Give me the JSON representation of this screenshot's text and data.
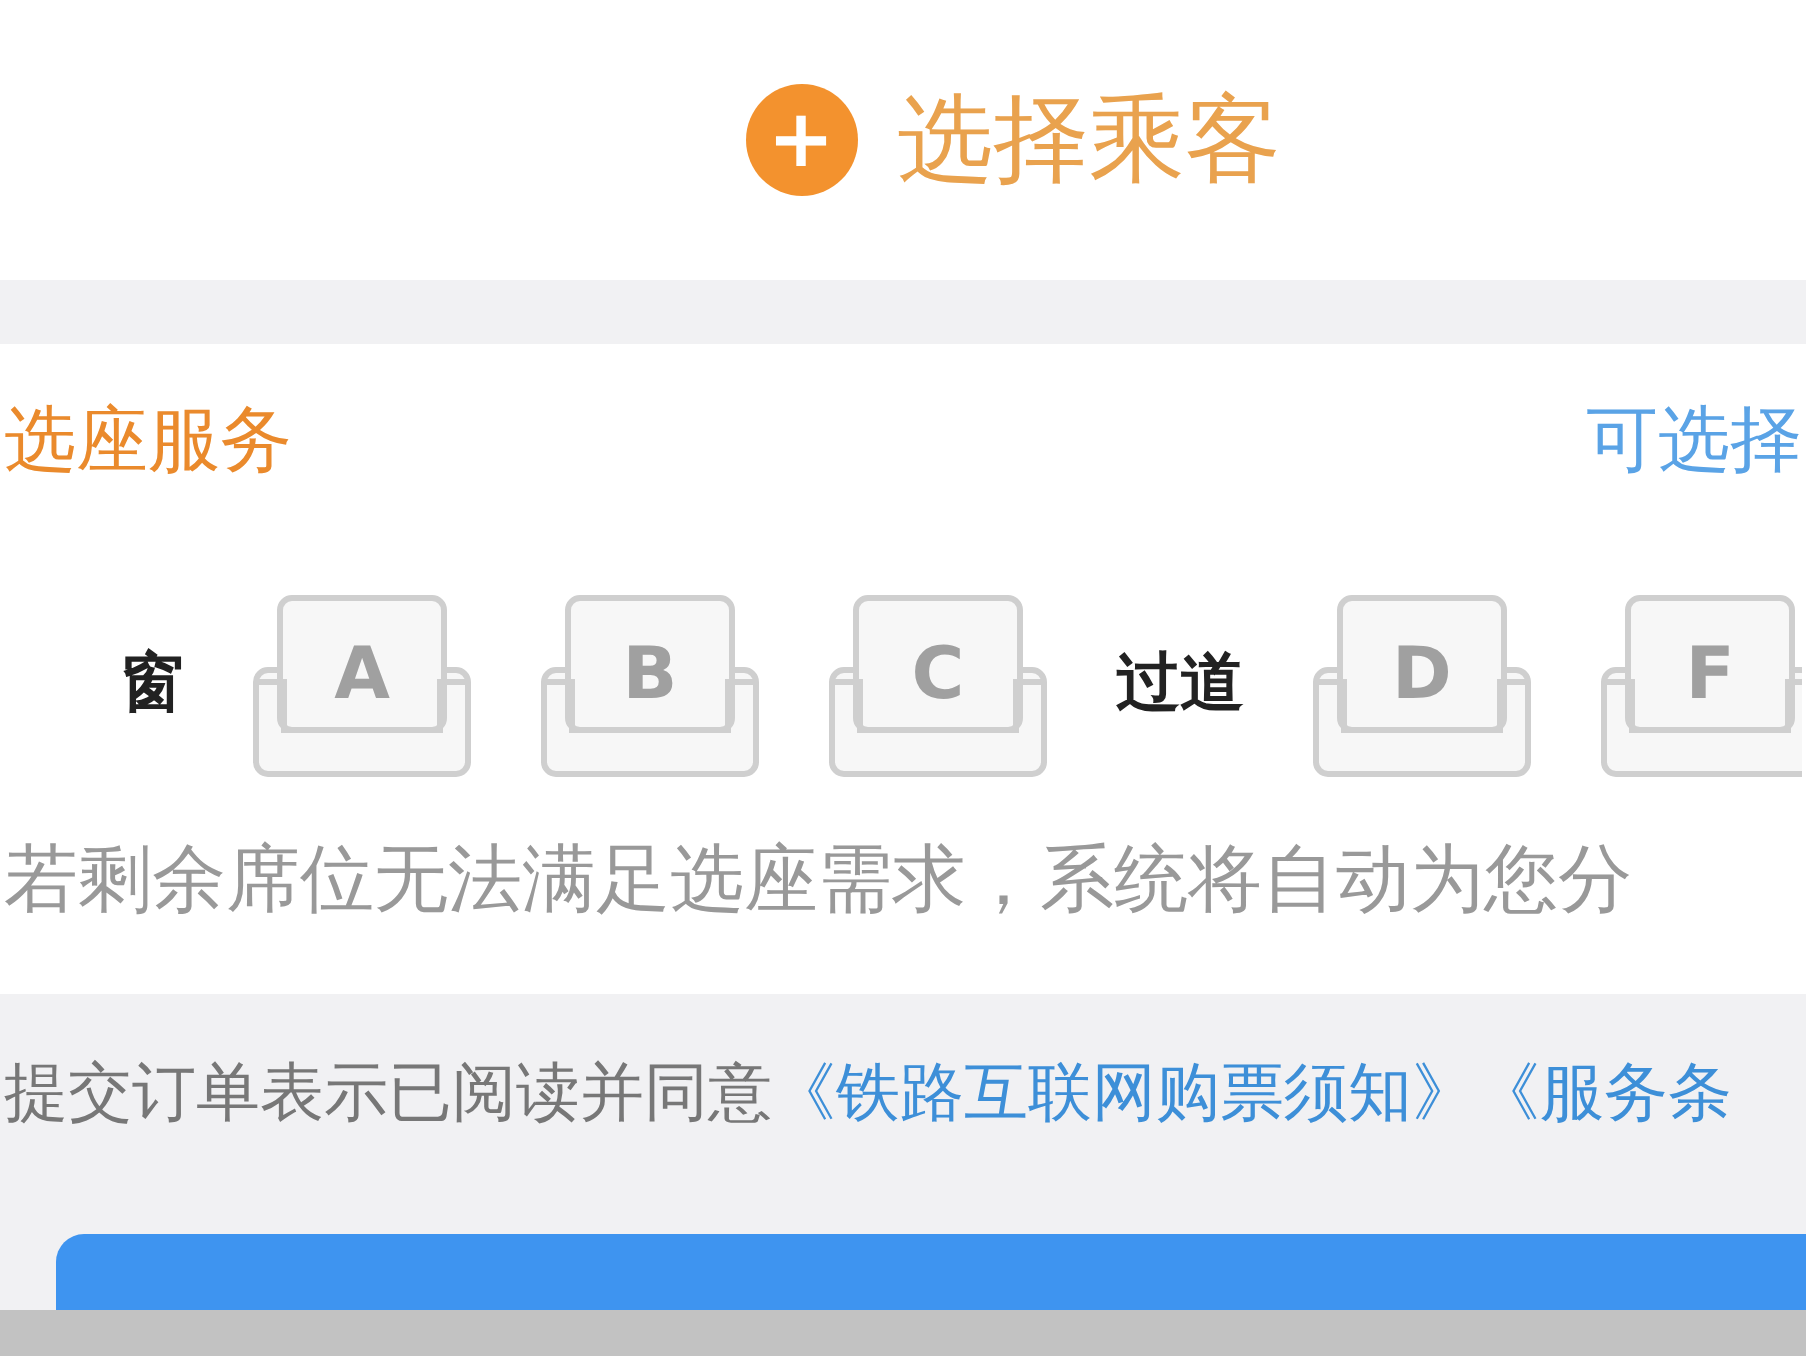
{
  "passenger": {
    "icon": "+",
    "label": "选择乘客"
  },
  "seat_service": {
    "title": "选座服务",
    "link": "可选择",
    "groups": [
      {
        "label": "窗",
        "seats": [
          {
            "letter": "A",
            "selected": false
          },
          {
            "letter": "B",
            "selected": false
          },
          {
            "letter": "C",
            "selected": false
          }
        ]
      },
      {
        "label": "过道",
        "seats": [
          {
            "letter": "D",
            "selected": false
          },
          {
            "letter": "F",
            "selected": false
          }
        ]
      }
    ],
    "hint": "若剩余席位无法满足选座需求，系统将自动为您分"
  },
  "agreement": {
    "text": "提交订单表示已阅读并同意",
    "links": [
      "《铁路互联网购票须知》",
      "《服务条"
    ]
  }
}
